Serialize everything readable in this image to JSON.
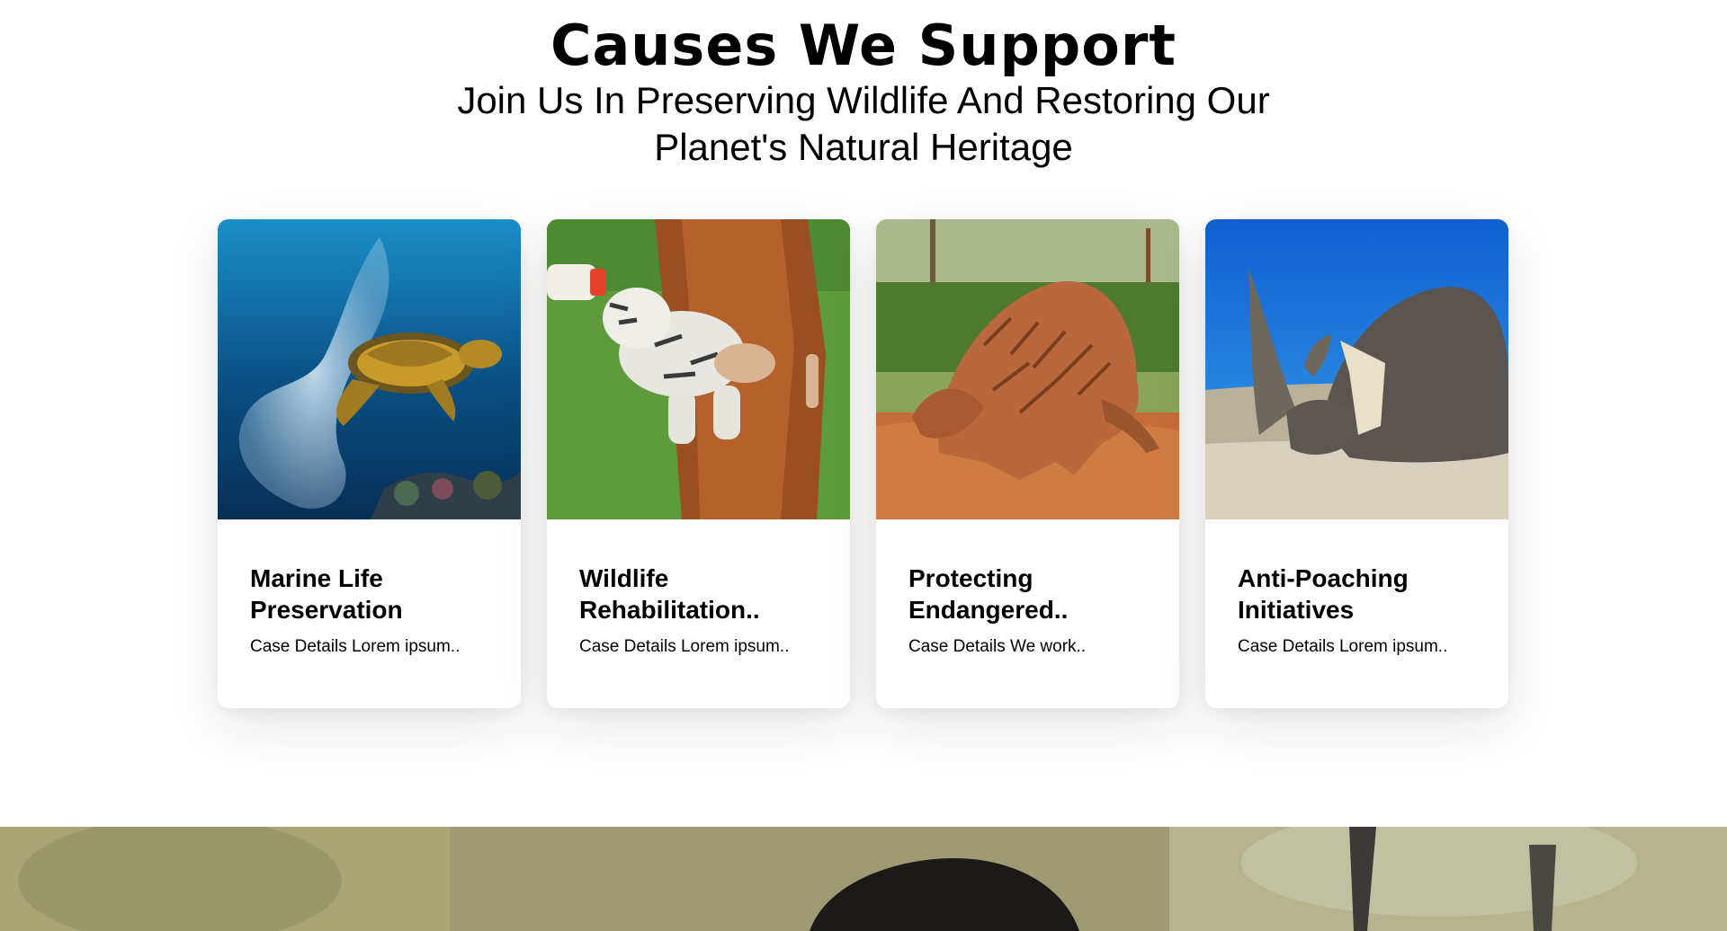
{
  "section": {
    "title": "Causes We Support",
    "subtitle": "Join Us In Preserving Wildlife And Restoring Our Planet's Natural Heritage"
  },
  "cards": [
    {
      "title": "Marine Life Preservation",
      "description": "Case Details Lorem ipsum..",
      "image": "sea-turtle-plastic-photo"
    },
    {
      "title": "Wildlife Rehabilitation..",
      "description": "Case Details Lorem ipsum..",
      "image": "tiger-cub-feeding-photo"
    },
    {
      "title": "Protecting Endangered..",
      "description": "Case Details We work..",
      "image": "pangolin-photo"
    },
    {
      "title": "Anti-Poaching Initiatives",
      "description": "Case Details Lorem ipsum..",
      "image": "rhino-photo"
    }
  ],
  "colors": {
    "ocean": "#0a5a8c",
    "grass": "#5a9a3a",
    "earth": "#c8703c",
    "sky": "#1a6fd6"
  }
}
